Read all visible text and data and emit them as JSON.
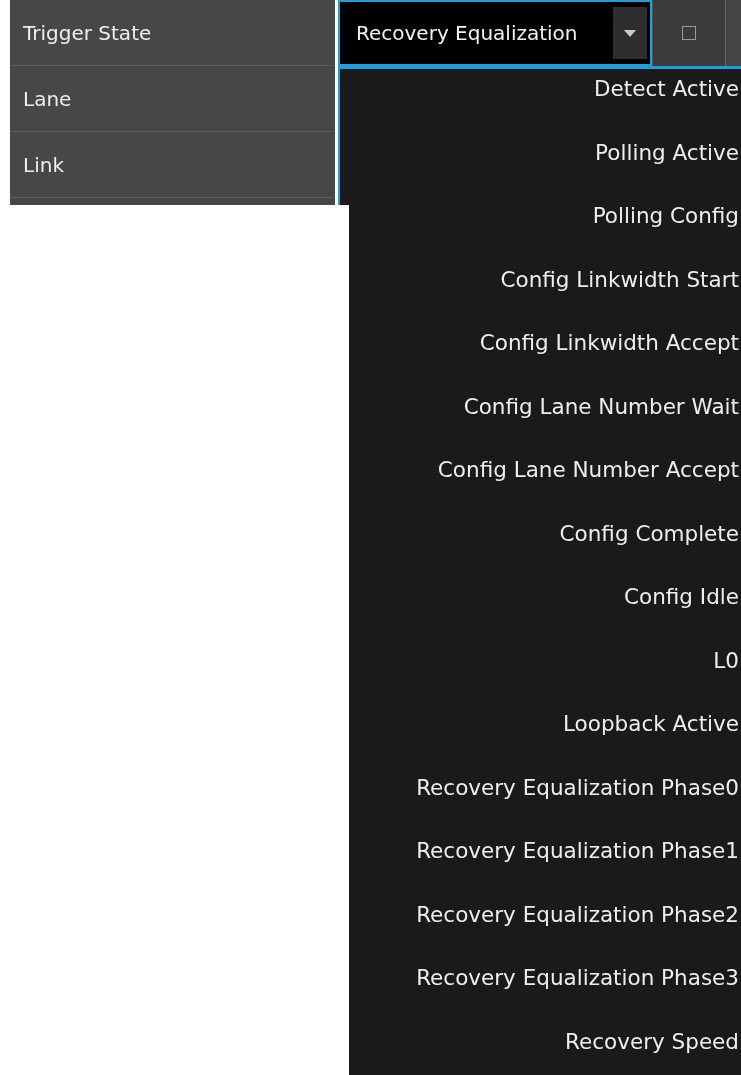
{
  "properties": [
    {
      "label": "Trigger State"
    },
    {
      "label": "Lane"
    },
    {
      "label": "Link"
    }
  ],
  "dropdown": {
    "value": "Recovery Equalization",
    "expanded": true,
    "checkbox": {
      "checked": false
    },
    "options": [
      "Detect Active",
      "Polling Active",
      "Polling Config",
      "Config Linkwidth Start",
      "Config Linkwidth Accept",
      "Config Lane Number Wait",
      "Config Lane Number Accept",
      "Config Complete",
      "Config Idle",
      "L0",
      "Loopback Active",
      "Recovery Equalization Phase0",
      "Recovery Equalization Phase1",
      "Recovery Equalization Phase2",
      "Recovery Equalization Phase3",
      "Recovery Speed"
    ]
  }
}
